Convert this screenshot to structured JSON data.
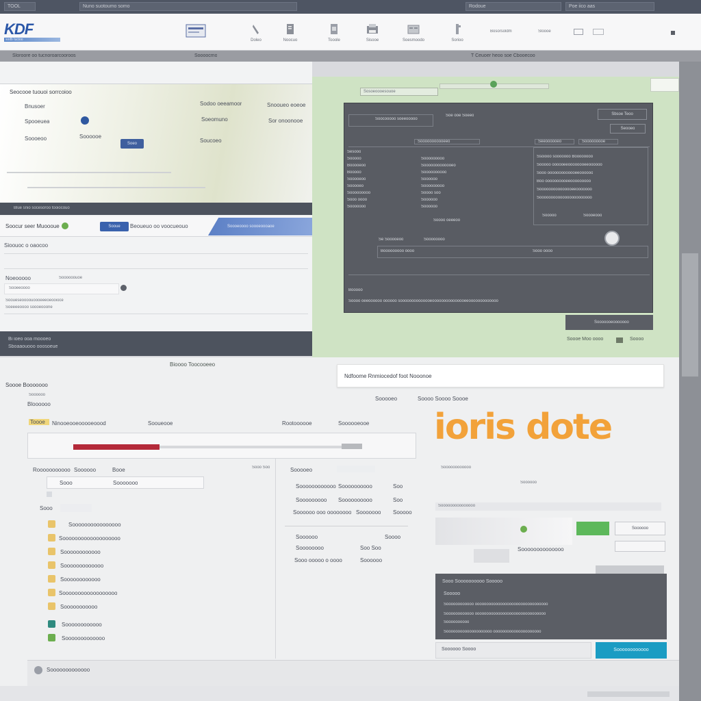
{
  "top_strip": {
    "segments": [
      "TOOL",
      "Nuno suotoumo somo",
      "Rodoue",
      "Poe iico aas"
    ]
  },
  "header": {
    "logo_text": "KDF",
    "logo_subtext": "sodb tucioo",
    "nav_items": [
      {
        "label": "Doleo"
      },
      {
        "label": "Noocuo"
      },
      {
        "label": "Tooole"
      },
      {
        "label": "Sisooe"
      },
      {
        "label": "Soesmoodo"
      },
      {
        "label": "Sorioo"
      }
    ],
    "right_links": [
      "Bosorsoldm",
      "Sloooe"
    ],
    "right_icons": [
      "grid-icon",
      "menu-icon"
    ]
  },
  "band": {
    "left_text": "Sloroore oo tucnoroarcooroos",
    "mid_text": "Soooocmo",
    "right_text": "T Ceuoer heoo soe Cbooecoo"
  },
  "left_panel": {
    "card_title": "Seocooe tuouoi sorrcoioo",
    "rows": [
      {
        "left": "Bnusoer",
        "mid": "Sodoo oeeamoor",
        "right": "Snooueo eoeoe"
      },
      {
        "left": "Spooeuea",
        "mid": "Soeomuno",
        "right": "Sor onoonooe"
      },
      {
        "left": "Soooeoo",
        "mid": "Soooooe",
        "right": "Soucoeo"
      }
    ],
    "selected_chip": "Soeo",
    "strip_text": "Blue snio socesoroo tooiocouo",
    "tab_active": "Soocur seer Muoooue",
    "tab_button": "Sooue",
    "tab_secondary": "Beoueuo oo voocueouo",
    "tab_link": "Soooeoooo soooeoooaoe",
    "section_label": "Sioouoc o oaocoo",
    "field_label": "Noeooooo",
    "field_value": "Soooooouoe",
    "field_value2": "Sooeeoooo",
    "field_help1": "Sooueseoooouoooeeeoeooioce",
    "field_help2": "Soeeeeoooo soooeooone",
    "footer_line1": "Bi ioeo ooa moooeo",
    "footer_line2": "Sboaaouooo ooosoeue"
  },
  "green_panel": {
    "top_field": "Sosoeoooesouoe",
    "card": {
      "title_field": "Soocooooo soeeooooo",
      "title_center": "Soe ooe Soeeo",
      "top_btn1": "Sbsoe Teoo",
      "top_btn2": "Seooeo",
      "tab1": "Sooooooooooeeo",
      "tab2": "Seeoooooeo",
      "tab3": "Sooooooooe",
      "left_labels": [
        "Sesooo",
        "Sooooo",
        "Booooeoo",
        "Booooo",
        "Sooooeoo",
        "Sooooeo",
        "Sooooooooo",
        "Sooo oooo",
        "Sooooooo",
        "Booooo"
      ],
      "mid_values": [
        "Sooooooooo",
        "Sooooooooooooeo",
        "Soooooooooo",
        "Soooooo",
        "Sooooooooo",
        "Soooo soo",
        "Soooooo",
        "Soooooo"
      ],
      "right_lines": [
        "Ssoiooo sooooooo Boooooooo",
        "Sooooo oooooeeoooooooeeoooooo",
        "Sooo ooooooooooooeeoooooo",
        "Boo oooooooooeeooooooooo",
        "Sooooooooooooooeeooooooo",
        "Sooooooooooooooooooooooo"
      ],
      "center_label": "Soooo oeeeoo",
      "right_small1": "Sooooo",
      "right_small2": "Soooeooo",
      "bottom_line1": "Se Sooooeoo",
      "bottom_line2": "Soooooooo",
      "bottom_line3": "Booooooooo oooo",
      "bottom_line4": "Sooo oooo",
      "footer_label": "Booooo",
      "footer_line": "Soooo oeeoooooo oooooo soooooooooooooeooooooooooooooeeooooooooooooo"
    },
    "bottom_btn": "Sooooooeooooooo",
    "bottom_text": "Soooe Moo oooo",
    "bottom_link": "Soooo"
  },
  "bottom": {
    "popup_text": "Ndfoome Rnmiocedof foot Nooonoe",
    "section_title": "Soooe Booooooo",
    "section_subtitle": "Bioooo Toocooeeo",
    "label1": "Soooooo",
    "label2": "Bloooooo",
    "header_right1": "Sooooeo",
    "header_right2": "Soooo Soooo Soooe",
    "progress_labels": [
      "Toooe",
      "Ninooeooeooooeoood",
      "Sooueooe",
      "Rootoooooe",
      "Soooooeooe"
    ],
    "progress_value": 0.3,
    "form_labels": [
      "Rooooooooooo",
      "Soooooo",
      "Booe"
    ],
    "form_value1": "Sooo",
    "form_value2": "Sooooooo",
    "form_small": "Sooo Soo",
    "checkbox_label": "Sooo",
    "list_items": [
      "Soooooooooooooooo",
      "Sooooooooooooooooooo",
      "Soooooooooooo",
      "Sooooooooooooo",
      "Soooooooooooo",
      "Soooooooooooooooooo",
      "Sooooooooooo",
      "Soooooooooooo",
      "Sooooooooooooo"
    ],
    "mid_rows": [
      {
        "label": "Soooooooooooo",
        "value": "Soooooooooo",
        "right": "Soo"
      },
      {
        "label": "Sooooooooo",
        "value": "Soooooooooo",
        "right": "Soo"
      },
      {
        "label": "Soooooo ooo oooooooo",
        "value": "Sooooooo",
        "right": "Sooooo"
      }
    ],
    "mid_rows2": [
      {
        "label": "Soooooo",
        "value": "Soooo"
      },
      {
        "label": "Soooooooo",
        "value": "Soo Soo"
      },
      {
        "label": "Sooo ooooo o oooo",
        "value": "Soooooo"
      }
    ],
    "brand_text": "ioris dote",
    "brand_sub": "Soooooooooooo",
    "brand_sub2": "Soooooo",
    "right_search": "Sooooooooooooooo",
    "right_btn": "Soooooo",
    "right_link": "Soooooooooooooo",
    "dark_title": "Sooo Soooooooooo Sooooo",
    "dark_label": "Sooooo",
    "dark_lines": [
      "Soooooooooooo oooooooooooooooooooooooooooooooo",
      "Soooooooooooo ooooooooooooooooooooooooooooooo",
      "Soooooooooo",
      "Soooooooooooooooooooo ooooooooooooooooooooo"
    ],
    "dark_footer": "Soooooo Soooo",
    "teal_btn": "Soooooooooooo",
    "footer_text": "Sooooooooooooo",
    "footer_icon": "Ndf Soooooooooo"
  }
}
